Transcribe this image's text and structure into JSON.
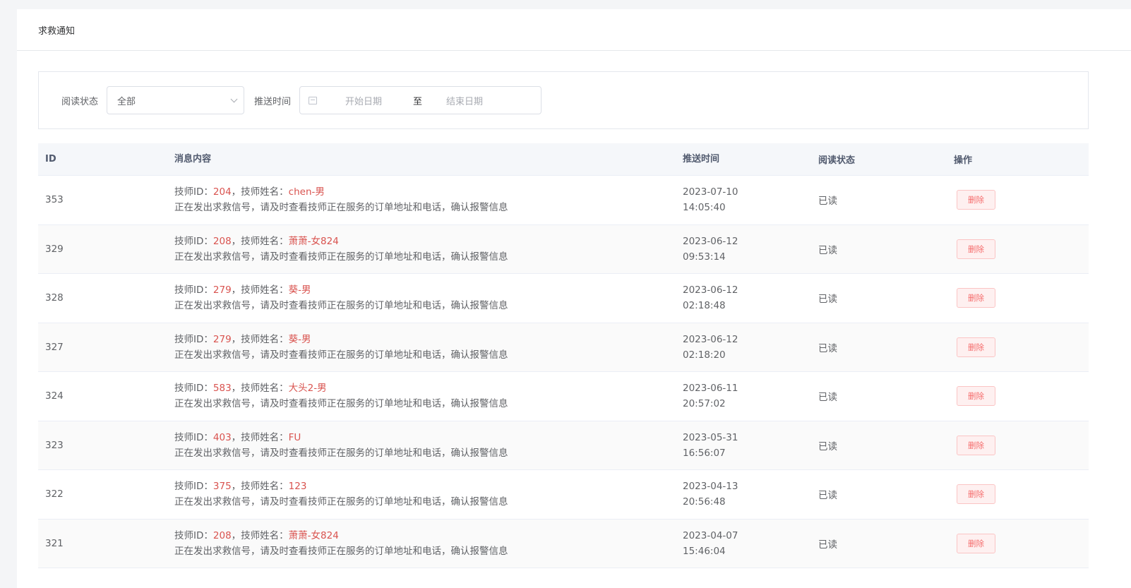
{
  "page": {
    "title": "求救通知"
  },
  "filters": {
    "read_status_label": "阅读状态",
    "read_status_value": "全部",
    "push_time_label": "推送时间",
    "start_placeholder": "开始日期",
    "range_separator": "至",
    "end_placeholder": "结束日期"
  },
  "table": {
    "headers": {
      "id": "ID",
      "content": "消息内容",
      "time": "推送时间",
      "status": "阅读状态",
      "action": "操作"
    },
    "rows": [
      {
        "id": "353",
        "tech_id": "204",
        "tech_name": "chen-男",
        "date": "2023-07-10",
        "clock": "14:05:40",
        "status": "已读",
        "action": "删除"
      },
      {
        "id": "329",
        "tech_id": "208",
        "tech_name": "萧萧-女824",
        "date": "2023-06-12",
        "clock": "09:53:14",
        "status": "已读",
        "action": "删除"
      },
      {
        "id": "328",
        "tech_id": "279",
        "tech_name": "葵-男",
        "date": "2023-06-12",
        "clock": "02:18:48",
        "status": "已读",
        "action": "删除"
      },
      {
        "id": "327",
        "tech_id": "279",
        "tech_name": "葵-男",
        "date": "2023-06-12",
        "clock": "02:18:20",
        "status": "已读",
        "action": "删除"
      },
      {
        "id": "324",
        "tech_id": "583",
        "tech_name": "大头2-男",
        "date": "2023-06-11",
        "clock": "20:57:02",
        "status": "已读",
        "action": "删除"
      },
      {
        "id": "323",
        "tech_id": "403",
        "tech_name": "FU",
        "date": "2023-05-31",
        "clock": "16:56:07",
        "status": "已读",
        "action": "删除"
      },
      {
        "id": "322",
        "tech_id": "375",
        "tech_name": "123",
        "date": "2023-04-13",
        "clock": "20:56:48",
        "status": "已读",
        "action": "删除"
      },
      {
        "id": "321",
        "tech_id": "208",
        "tech_name": "萧萧-女824",
        "date": "2023-04-07",
        "clock": "15:46:04",
        "status": "已读",
        "action": "删除"
      }
    ],
    "msg_prefix_id": "技师ID：",
    "msg_mid_name": "，技师姓名：",
    "msg_body": "正在发出求救信号，请及时查看技师正在服务的订单地址和电话，确认报警信息"
  },
  "colors": {
    "highlight": "#d9534f",
    "danger": "#f56c6c"
  }
}
